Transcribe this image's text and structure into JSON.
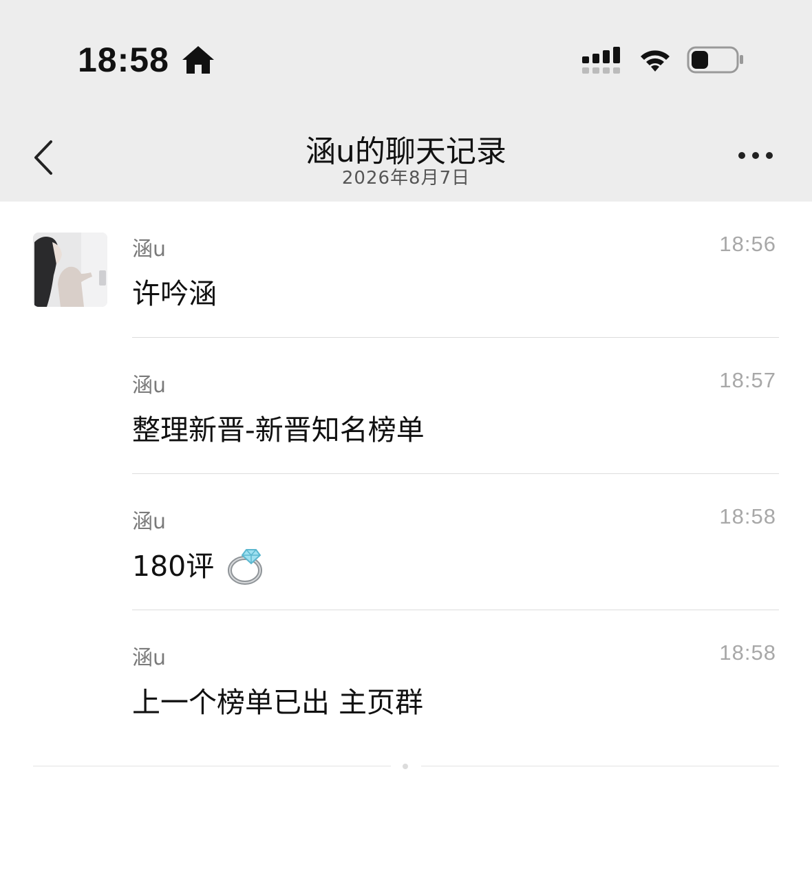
{
  "status_bar": {
    "time": "18:58",
    "icons": [
      "home-icon",
      "signal-icon",
      "wifi-icon",
      "battery-icon"
    ]
  },
  "nav": {
    "title": "涵u的聊天记录",
    "subtitle": "2026年8月7日",
    "back_icon": "chevron-left-icon",
    "more_icon": "more-icon"
  },
  "messages": [
    {
      "sender": "涵u",
      "time": "18:56",
      "text": "许吟涵"
    },
    {
      "sender": "涵u",
      "time": "18:57",
      "text": "整理新晋-新晋知名榜单"
    },
    {
      "sender": "涵u",
      "time": "18:58",
      "text": "180评",
      "emoji": "ring-icon"
    },
    {
      "sender": "涵u",
      "time": "18:58",
      "text": "上一个榜单已出 主页群"
    }
  ],
  "colors": {
    "header_bg": "#ededed",
    "body_bg": "#ffffff",
    "text": "#111111",
    "muted": "#7a7a7a"
  }
}
